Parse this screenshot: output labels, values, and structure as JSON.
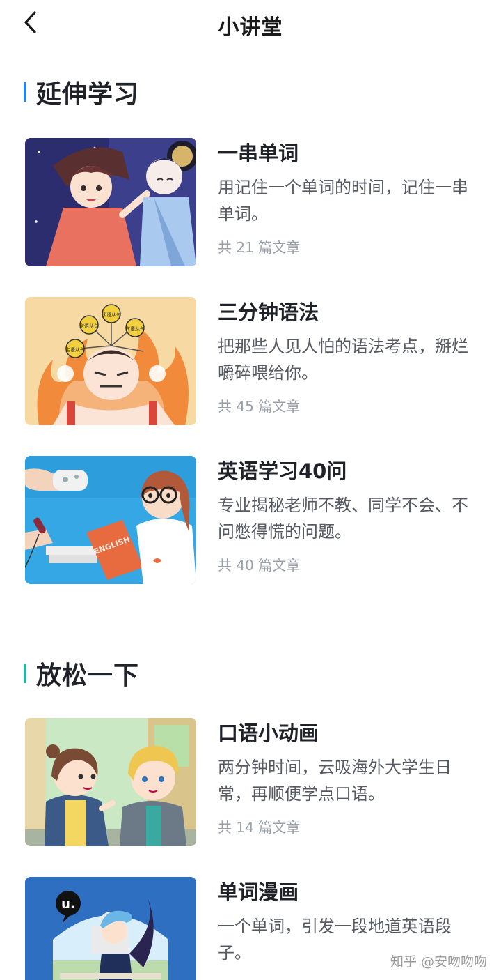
{
  "header": {
    "title": "小讲堂",
    "back_icon": "chevron-left-icon"
  },
  "sections": [
    {
      "title": "延伸学习",
      "accent": "#1e88e5",
      "cards": [
        {
          "title": "一串单词",
          "desc": "用记住一个单词的时间，记住一串单词。",
          "count": "共 21 篇文章"
        },
        {
          "title": "三分钟语法",
          "desc": "把那些人见人怕的语法考点，掰烂嚼碎喂给你。",
          "count": "共 45 篇文章"
        },
        {
          "title": "英语学习40问",
          "desc": "专业揭秘老师不教、同学不会、不问憋得慌的问题。",
          "count": "共 40 篇文章"
        }
      ]
    },
    {
      "title": "放松一下",
      "accent": "#26b5a2",
      "cards": [
        {
          "title": "口语小动画",
          "desc": "两分钟时间，云吸海外大学生日常，再顺便学点口语。",
          "count": "共 14 篇文章"
        },
        {
          "title": "单词漫画",
          "desc": "一个单词，引发一段地道英语段子。",
          "count": ""
        }
      ]
    }
  ],
  "thumb_text": {
    "book": "ENGLISH",
    "badges": [
      "定语从句",
      "状语从句",
      "主语从句",
      "宾语从句"
    ],
    "logo": "u."
  },
  "watermark": "知乎 @安吻吻吻"
}
